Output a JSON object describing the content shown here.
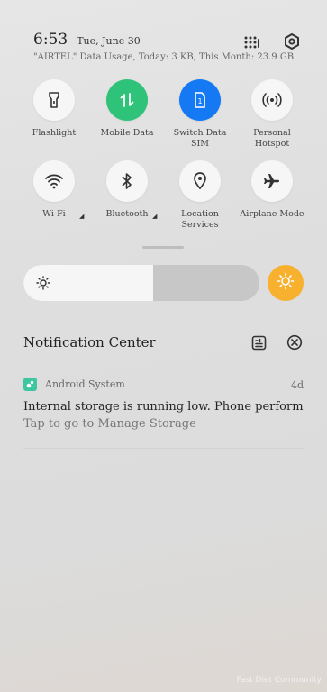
{
  "status_bar": {
    "time": "6:53",
    "date": "Tue, June 30",
    "usage": "\"AIRTEL\" Data Usage, Today: 3 KB, This Month: 23.9 GB",
    "icons": [
      "grid-edit-icon",
      "settings-gear-icon"
    ]
  },
  "tiles": [
    {
      "label": "Flashlight",
      "icon": "flashlight-icon",
      "state": "off"
    },
    {
      "label": "Mobile Data",
      "icon": "mobile-data-icon",
      "state": "on",
      "color": "#2fc37a"
    },
    {
      "label": "Switch Data\nSIM",
      "icon": "sim-icon",
      "state": "on",
      "color": "#1479f2"
    },
    {
      "label": "Personal\nHotspot",
      "icon": "hotspot-icon",
      "state": "off"
    },
    {
      "label": "Wi-Fi",
      "icon": "wifi-icon",
      "state": "off"
    },
    {
      "label": "Bluetooth",
      "icon": "bluetooth-icon",
      "state": "off"
    },
    {
      "label": "Location\nServices",
      "icon": "location-icon",
      "state": "off"
    },
    {
      "label": "Airplane Mode",
      "icon": "airplane-icon",
      "state": "off"
    }
  ],
  "brightness": {
    "level": 0.55,
    "auto_color": "#f7b12e"
  },
  "notification_center": {
    "title": "Notification Center",
    "notifications": [
      {
        "app": "Android System",
        "time": "4d",
        "title": "Internal storage is running low. Phone performance i..",
        "body": "Tap to go to Manage Storage"
      }
    ]
  },
  "watermark": "Fast Diet Community"
}
